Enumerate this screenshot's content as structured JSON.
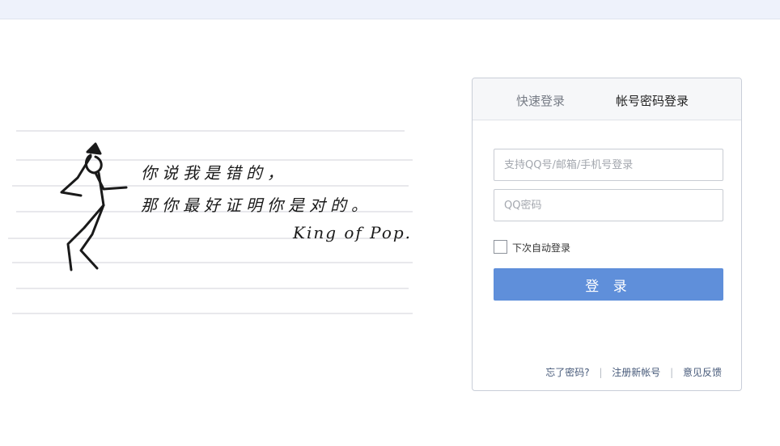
{
  "art": {
    "line1": "你说我是错的，",
    "line2": "那你最好证明你是对的。",
    "signature": "King of Pop."
  },
  "login": {
    "tabs": [
      {
        "label": "快速登录"
      },
      {
        "label": "帐号密码登录"
      }
    ],
    "username_placeholder": "支持QQ号/邮箱/手机号登录",
    "password_placeholder": "QQ密码",
    "remember_label": "下次自动登录",
    "submit_label": "登 录",
    "links": {
      "forgot": "忘了密码?",
      "register": "注册新帐号",
      "feedback": "意见反馈",
      "separator": "|"
    }
  },
  "colors": {
    "accent": "#5f8fda",
    "topbar": "#eef2fb",
    "link": "#475a7a"
  }
}
